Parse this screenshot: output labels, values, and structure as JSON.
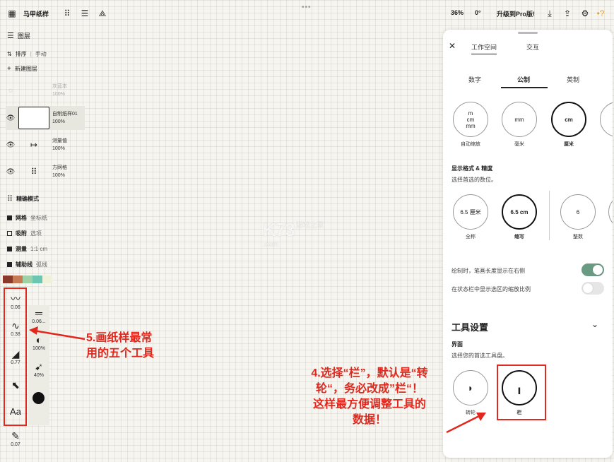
{
  "topbar": {
    "title": "马甲纸样",
    "zoom": "36%",
    "rotation": "0°",
    "upgrade": "升级到Pro版!"
  },
  "left_panel": {
    "layers_title": "图层",
    "sort_label": "排序",
    "sort_mode": "手动",
    "new_layer": "新建图层",
    "layers": [
      {
        "name": "灰蓝本",
        "opacity": "100%"
      },
      {
        "name": "自制纸样01",
        "opacity": "100%"
      },
      {
        "name": "测量值",
        "opacity": "100%"
      },
      {
        "name": "方网格",
        "opacity": "100%"
      }
    ],
    "precision_title": "精确模式",
    "precision_rows": [
      {
        "label": "网格",
        "value": "坐标纸",
        "checked": true
      },
      {
        "label": "吸附",
        "value": "选项",
        "checked": false
      },
      {
        "label": "测量",
        "value": "1:1 cm",
        "checked": true
      },
      {
        "label": "辅助线",
        "value": "弧线",
        "checked": true
      }
    ],
    "swatches": [
      "#8a3a2a",
      "#c77b55",
      "#9fd0a6",
      "#6cc7b2",
      "#f1f0d9"
    ]
  },
  "tools": {
    "main": [
      {
        "icon": "pen-curve-icon",
        "glyph": "〰",
        "value": "0.06"
      },
      {
        "icon": "s-curve-icon",
        "glyph": "∿",
        "value": "0.38"
      },
      {
        "icon": "wedge-icon",
        "glyph": "◢",
        "value": "0.77"
      },
      {
        "icon": "pointer-icon",
        "glyph": "⬉",
        "value": ""
      },
      {
        "icon": "text-icon",
        "glyph": "Aa",
        "value": ""
      }
    ],
    "extra": {
      "glyph": "✎",
      "value": "0.07"
    },
    "props": [
      {
        "icon": "stroke-width-icon",
        "glyph": "═",
        "value": "0.06..."
      },
      {
        "icon": "opacity-icon",
        "glyph": "◐",
        "value": "100%"
      },
      {
        "icon": "smoothing-icon",
        "glyph": "➹",
        "value": "40%"
      }
    ]
  },
  "annotations": {
    "left_line1": "5.画纸样最常",
    "left_line2": "用的五个工具",
    "right_line1": "4.选择“栏”，默认是“转",
    "right_line2": "轮“，务必改成”栏“！",
    "right_line3": "这样最方便调整工具的",
    "right_line4": "数据！"
  },
  "watermark": {
    "brand": "K73",
    "site": "游戏之家",
    "domain": ".com"
  },
  "panel": {
    "tabs": [
      "工作空间",
      "交互"
    ],
    "unit_tabs": [
      "数字",
      "公制",
      "英制"
    ],
    "active_unit_tab": 1,
    "unit_options": [
      {
        "label": "m\ncm\nmm",
        "caption": "自动缩放",
        "selected": false
      },
      {
        "label": "mm",
        "caption": "毫米",
        "selected": false
      },
      {
        "label": "cm",
        "caption": "厘米",
        "selected": true
      }
    ],
    "format_title": "显示格式 & 精度",
    "format_sub": "选择首选的数位。",
    "format_options": [
      {
        "label": "6.5 厘米",
        "caption": "全称",
        "selected": false
      },
      {
        "label": "6.5 cm",
        "caption": "缩写",
        "selected": true
      },
      {
        "label": "6",
        "caption": "整数",
        "selected": false
      }
    ],
    "toggles": [
      {
        "label": "绘制时，笔画长度显示在右侧",
        "on": true
      },
      {
        "label": "在状态栏中显示选区的缩放比例",
        "on": false
      }
    ],
    "tool_settings_title": "工具设置",
    "interface_title": "界面",
    "interface_sub": "选择您的首选工具盘。",
    "toolbox_options": [
      {
        "caption": "转轮",
        "selected": false
      },
      {
        "caption": "栏",
        "selected": true
      }
    ]
  },
  "colors": {
    "accent_red": "#e0281e",
    "toggle_on": "#6a9a82"
  }
}
